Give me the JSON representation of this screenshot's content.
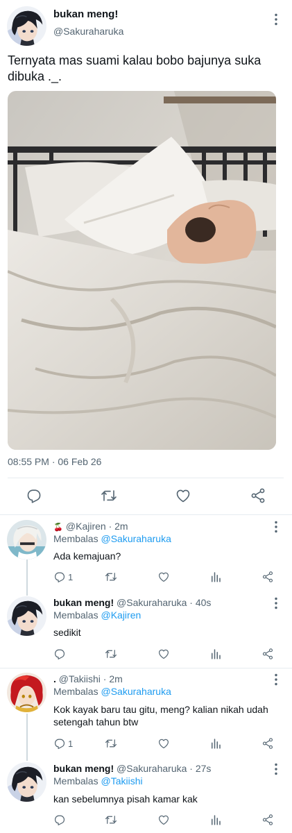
{
  "main_tweet": {
    "display_name": "bukan meng!",
    "handle": "@Sakuraharuka",
    "text": "Ternyata mas suami kalau bobo bajunya suka dibuka ._.",
    "timestamp": "08:55 PM · 06 Feb 26",
    "actions": [
      "reply-icon",
      "retweet-icon",
      "like-icon",
      "share-icon"
    ]
  },
  "reply_prefix": "Membalas",
  "replies": [
    {
      "display_name": "",
      "badge_icon": "cherry-emoji-icon",
      "handle": "@Kajiren",
      "time": "· 2m",
      "replying_to": "@Sakuraharuka",
      "text": "Ada kemajuan?",
      "reply_count": "1"
    },
    {
      "display_name": "bukan meng!",
      "handle": "@Sakuraharuka",
      "time": "· 40s",
      "replying_to": "@Kajiren",
      "text": "sedikit",
      "reply_count": ""
    },
    {
      "display_name": ".",
      "handle": "@Takiishi",
      "time": "· 2m",
      "replying_to": "@Sakuraharuka",
      "text": "Kok kayak baru tau gitu, meng? kalian nikah udah setengah tahun btw",
      "reply_count": "1"
    },
    {
      "display_name": "bukan meng!",
      "handle": "@Sakuraharuka",
      "time": "· 27s",
      "replying_to": "@Takiishi",
      "text": "kan sebelumnya pisah kamar kak",
      "reply_count": ""
    }
  ],
  "colors": {
    "link": "#1d9bf0",
    "secondary": "#536471",
    "text": "#0f1419",
    "divider": "#e6ecf0"
  }
}
